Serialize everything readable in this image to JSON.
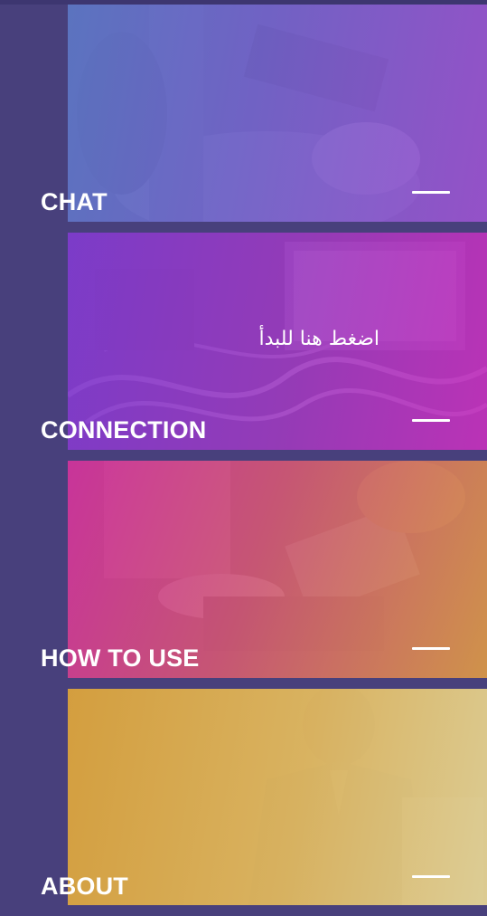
{
  "menu": {
    "items": [
      {
        "label": "CHAT",
        "icon": "dash-icon"
      },
      {
        "label": "CONNECTION",
        "icon": "dash-icon"
      },
      {
        "label": "HOW TO USE",
        "icon": "dash-icon"
      },
      {
        "label": "ABOUT",
        "icon": "dash-icon"
      }
    ]
  },
  "overlay": {
    "hint": "اضغط هنا للبدأ"
  },
  "colors": {
    "background": "#48407c",
    "text": "#ffffff"
  }
}
